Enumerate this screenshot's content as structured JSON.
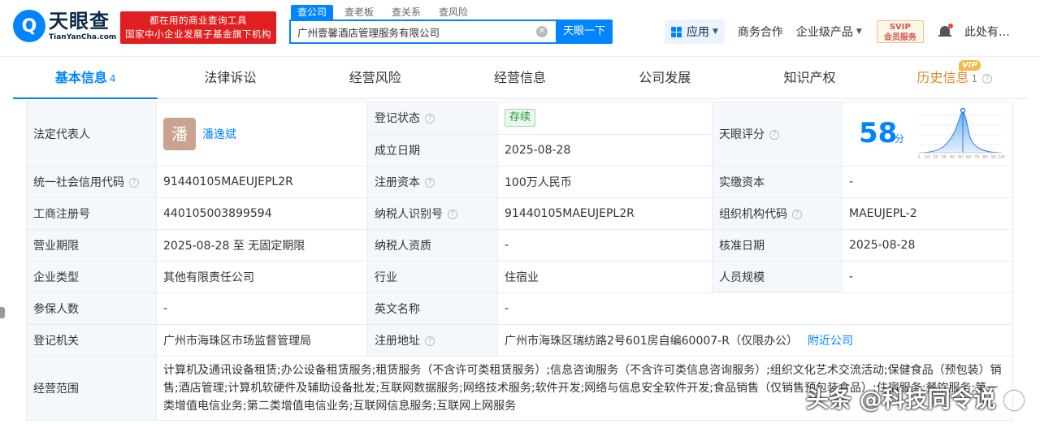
{
  "header": {
    "logo_glyph": "Q",
    "logo_cn": "天眼查",
    "logo_en": "TianYanCha.com",
    "promo_line1": "都在用的商业查询工具",
    "promo_line2": "国家中小企业发展子基金旗下机构",
    "search_tabs": [
      "查公司",
      "查老板",
      "查关系",
      "查风险"
    ],
    "search_value": "广州壹馨酒店管理服务有限公司",
    "search_button": "天眼一下",
    "apps_label": "应用",
    "business": "商务合作",
    "enterprise": "企业级产品",
    "vip_line1": "SVIP",
    "vip_line2": "会员服务",
    "user": "此处有…"
  },
  "tabs": [
    {
      "label": "基本信息",
      "count": "4"
    },
    {
      "label": "法律诉讼",
      "count": ""
    },
    {
      "label": "经营风险",
      "count": ""
    },
    {
      "label": "经营信息",
      "count": ""
    },
    {
      "label": "公司发展",
      "count": ""
    },
    {
      "label": "知识产权",
      "count": ""
    },
    {
      "label": "历史信息",
      "count": "1"
    }
  ],
  "vip_tag": "VIP",
  "info": {
    "legal_rep_label": "法定代表人",
    "legal_rep_avatar": "潘",
    "legal_rep_name": "潘逸斌",
    "reg_status_label": "登记状态",
    "reg_status": "存续",
    "found_date_label": "成立日期",
    "found_date": "2025-08-28",
    "score_label": "天眼评分",
    "score": "58",
    "score_unit": "分",
    "credit_code_label": "统一社会信用代码",
    "credit_code": "91440105MAEUJEPL2R",
    "reg_capital_label": "注册资本",
    "reg_capital": "100万人民币",
    "paid_capital_label": "实缴资本",
    "paid_capital": "-",
    "biz_reg_no_label": "工商注册号",
    "biz_reg_no": "440105003899594",
    "tax_id_label": "纳税人识别号",
    "tax_id": "91440105MAEUJEPL2R",
    "org_code_label": "组织机构代码",
    "org_code": "MAEUJEPL-2",
    "term_label": "营业期限",
    "term": "2025-08-28 至 无固定期限",
    "tax_qual_label": "纳税人资质",
    "tax_qual": "-",
    "approve_date_label": "核准日期",
    "approve_date": "2025-08-28",
    "company_type_label": "企业类型",
    "company_type": "其他有限责任公司",
    "industry_label": "行业",
    "industry": "住宿业",
    "staff_label": "人员规模",
    "staff": "-",
    "insured_label": "参保人数",
    "insured": "-",
    "en_name_label": "英文名称",
    "en_name": "-",
    "authority_label": "登记机关",
    "authority": "广州市海珠区市场监督管理局",
    "address_label": "注册地址",
    "address": "广州市海珠区瑞纺路2号601房自编60007-R（仅限办公）",
    "nearby": "附近公司",
    "scope_label": "经营范围",
    "scope": "计算机及通讯设备租赁;办公设备租赁服务;租赁服务（不含许可类租赁服务）;信息咨询服务（不含许可类信息咨询服务）;组织文化艺术交流活动;保健食品（预包装）销售;酒店管理;计算机软硬件及辅助设备批发;互联网数据服务;网络技术服务;软件开发;网络与信息安全软件开发;食品销售（仅销售预包装食品）;住宿服务;餐饮服务;第一类增值电信业务;第二类增值电信业务;互联网信息服务;互联网上网服务"
  },
  "score_axis": [
    "0",
    "10",
    "20",
    "30",
    "40",
    "50",
    "60",
    "70",
    "80",
    "90",
    "100"
  ],
  "watermark": "头条 @科技同令说",
  "colors": {
    "brand": "#0084ff",
    "promo": "#e02020",
    "history": "#d98b2b",
    "status_green": "#1a9a3c"
  }
}
